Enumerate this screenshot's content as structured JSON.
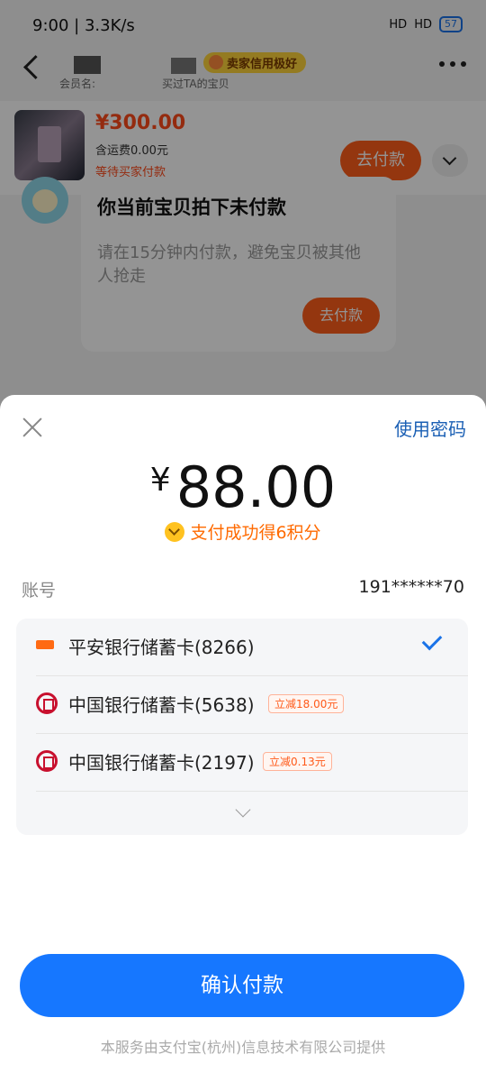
{
  "status_bar": {
    "time": "9:00",
    "speed": "3.3K/s",
    "network_1": "HD",
    "network_2": "HD",
    "battery": "57"
  },
  "nav": {
    "seller_name": "",
    "credit_badge": "卖家信用极好",
    "sub_left": "会员名:",
    "sub_right": "买过TA的宝贝"
  },
  "order": {
    "price": "¥300.00",
    "shipping": "含运费0.00元",
    "status": "等待买家付款",
    "pay_button": "去付款"
  },
  "message": {
    "title": "你当前宝贝拍下未付款",
    "text": "请在15分钟内付款，避免宝贝被其他人抢走",
    "button": "去付款"
  },
  "payment": {
    "use_password": "使用密码",
    "currency": "¥",
    "amount": "88.00",
    "points_text": "支付成功得6积分",
    "account_label": "账号",
    "account_value": "191******70",
    "cards": [
      {
        "name": "平安银行储蓄卡(8266)",
        "discount": "",
        "icon": "pingan-bank-icon",
        "selected": true
      },
      {
        "name": "中国银行储蓄卡(5638)",
        "discount": "立减18.00元",
        "icon": "boc-bank-icon",
        "selected": false
      },
      {
        "name": "中国银行储蓄卡(2197)",
        "discount": "立减0.13元",
        "icon": "boc-bank-icon",
        "selected": false
      }
    ],
    "confirm_button": "确认付款",
    "footer": "本服务由支付宝(杭州)信息技术有限公司提供"
  },
  "colors": {
    "primary_blue": "#1677ff",
    "accent_orange": "#ff5e1a",
    "link_blue": "#1a5fb4"
  }
}
